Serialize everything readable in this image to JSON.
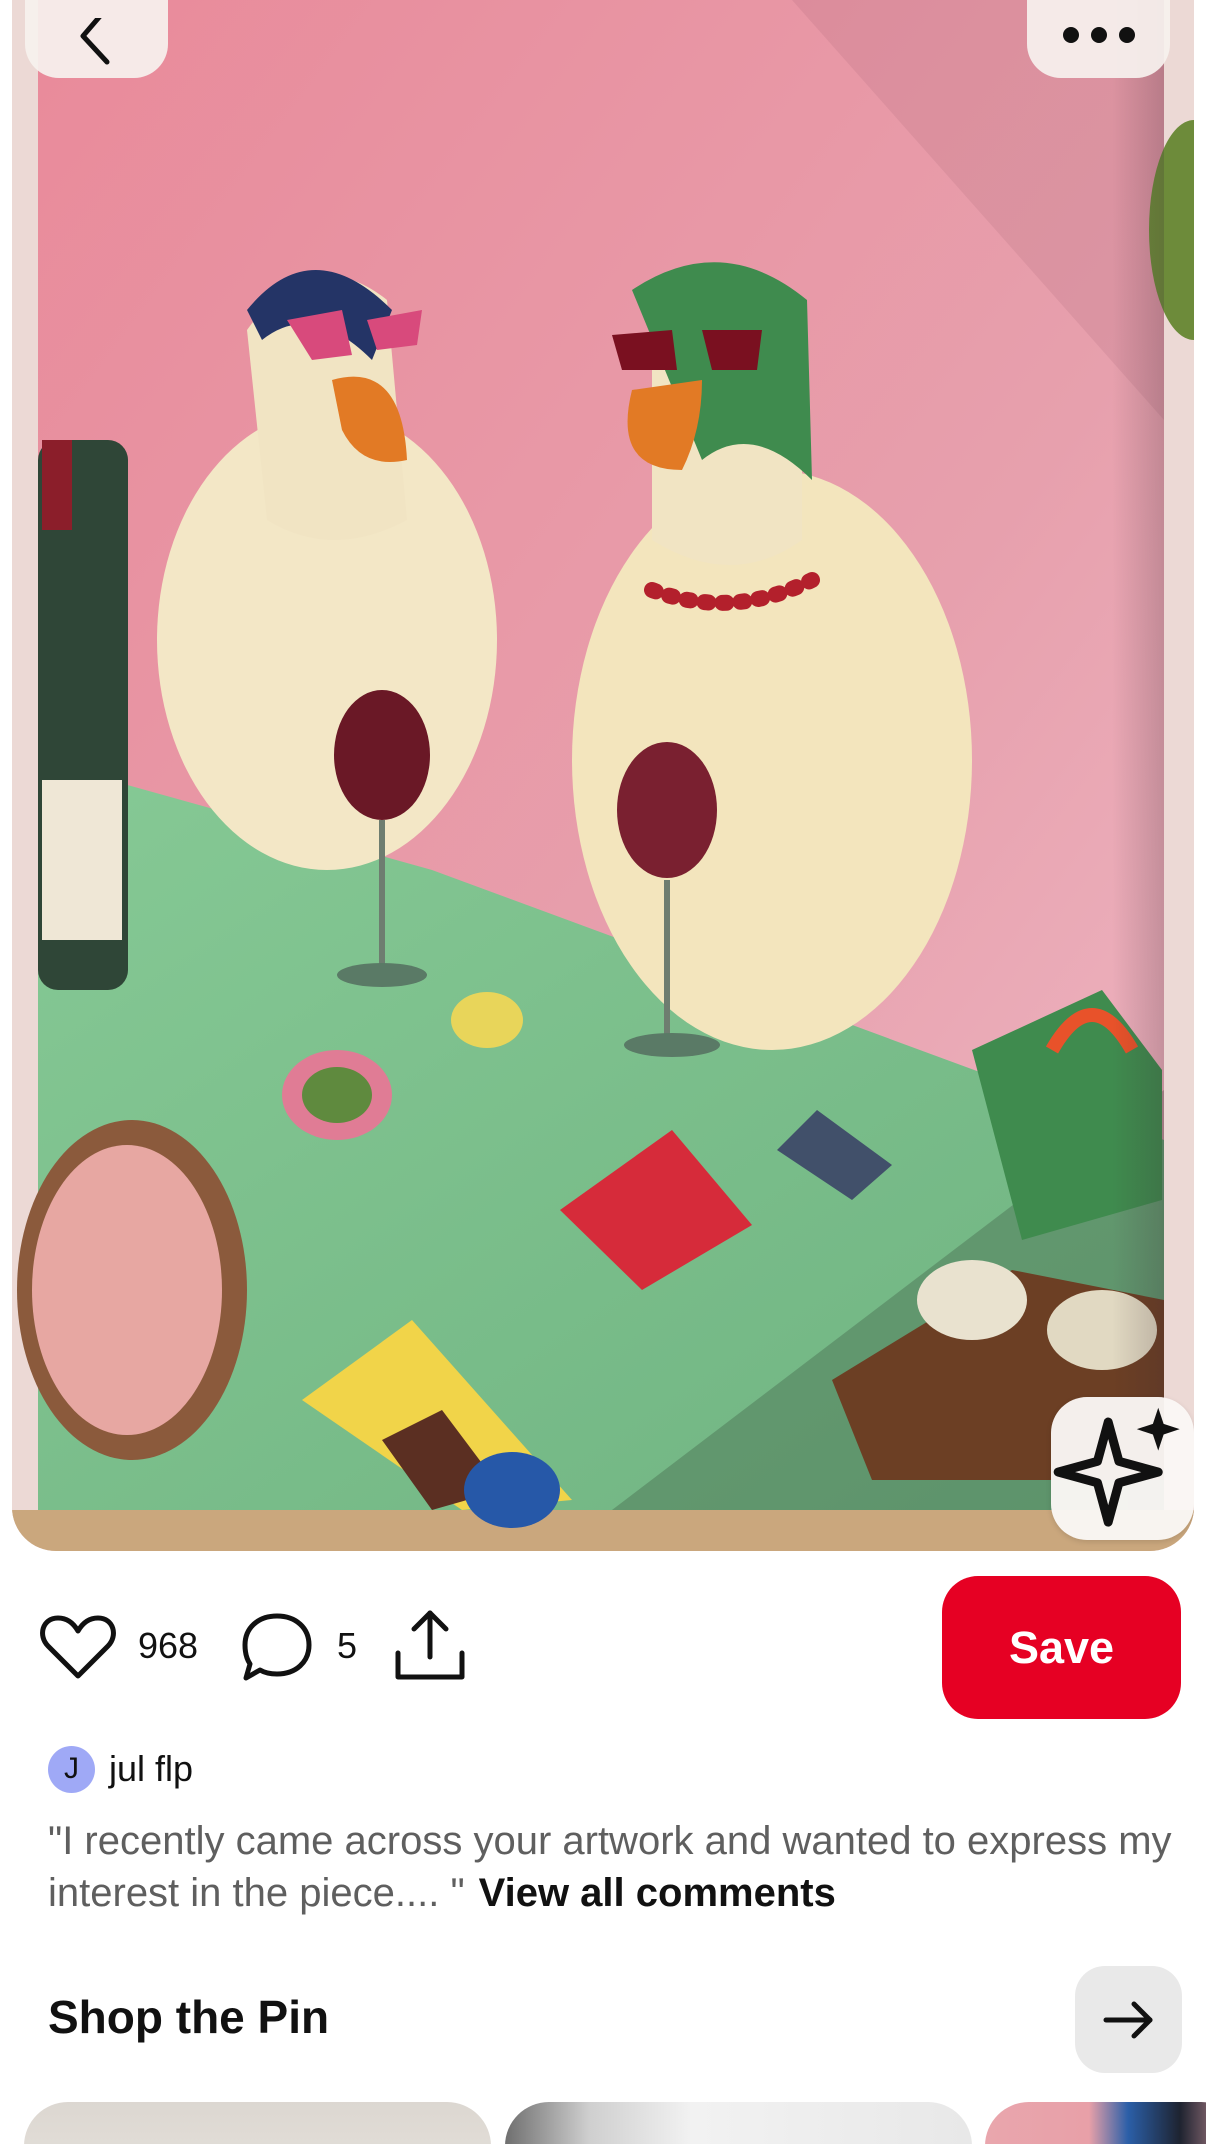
{
  "pin": {
    "colors": {
      "wall": "#e8929f",
      "table": "#7fc58f",
      "save": "#e60023",
      "avatar": "#9fa9f6"
    }
  },
  "toolbar": {
    "like_count": "968",
    "comment_count": "5",
    "save_label": "Save"
  },
  "creator": {
    "avatar_letter": "J",
    "name": "jul flp"
  },
  "comment": {
    "text": "\"I recently came across your artwork and wanted to express my interest in the piece.... \"",
    "view_all_label": "View all comments"
  },
  "shop": {
    "title": "Shop the Pin"
  },
  "icons": {
    "back": "chevron-left-icon",
    "more": "ellipsis-icon",
    "visual_search": "sparkle-icon",
    "like": "heart-icon",
    "comment": "speech-bubble-icon",
    "share": "share-icon",
    "arrow": "arrow-right-icon"
  }
}
